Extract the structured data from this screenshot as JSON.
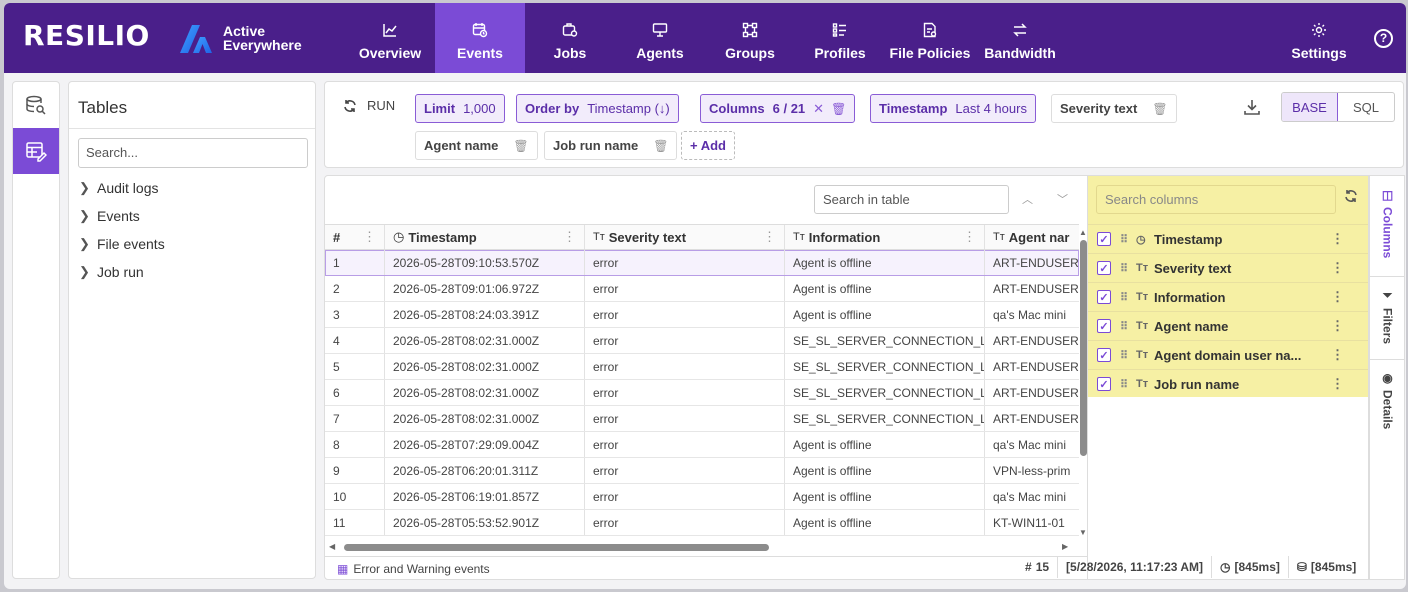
{
  "header": {
    "logo": "RESILIO",
    "product_line1": "Active",
    "product_line2": "Everywhere",
    "nav": [
      {
        "label": "Overview",
        "icon": "chart-line-icon"
      },
      {
        "label": "Events",
        "icon": "calendar-clock-icon",
        "active": true
      },
      {
        "label": "Jobs",
        "icon": "jobs-icon"
      },
      {
        "label": "Agents",
        "icon": "agents-icon"
      },
      {
        "label": "Groups",
        "icon": "groups-icon"
      },
      {
        "label": "Profiles",
        "icon": "profiles-icon"
      },
      {
        "label": "File Policies",
        "icon": "file-policies-icon"
      },
      {
        "label": "Bandwidth",
        "icon": "bandwidth-icon"
      }
    ],
    "settings_label": "Settings",
    "help_label": "?"
  },
  "tables_panel": {
    "title": "Tables",
    "search_placeholder": "Search...",
    "items": [
      "Audit logs",
      "Events",
      "File events",
      "Job run"
    ]
  },
  "query_bar": {
    "run_label": "RUN",
    "limit_key": "Limit",
    "limit_value": "1,000",
    "order_key": "Order by",
    "order_value": "Timestamp (↓)",
    "columns_key": "Columns",
    "columns_value": "6 / 21",
    "timestamp_key": "Timestamp",
    "timestamp_value": "Last 4 hours",
    "severity_chip": "Severity text",
    "agent_chip": "Agent name",
    "jobrun_chip": "Job run name",
    "add_label": "+ Add",
    "mode_base": "BASE",
    "mode_sql": "SQL"
  },
  "grid": {
    "search_placeholder": "Search in table",
    "columns": [
      "#",
      "Timestamp",
      "Severity text",
      "Information",
      "Agent nar"
    ],
    "rows": [
      [
        "1",
        "2026-05-28T09:10:53.570Z",
        "error",
        "Agent is offline",
        "ART-ENDUSER"
      ],
      [
        "2",
        "2026-05-28T09:01:06.972Z",
        "error",
        "Agent is offline",
        "ART-ENDUSER"
      ],
      [
        "3",
        "2026-05-28T08:24:03.391Z",
        "error",
        "Agent is offline",
        "qa's Mac mini"
      ],
      [
        "4",
        "2026-05-28T08:02:31.000Z",
        "error",
        "SE_SL_SERVER_CONNECTION_L...",
        "ART-ENDUSER"
      ],
      [
        "5",
        "2026-05-28T08:02:31.000Z",
        "error",
        "SE_SL_SERVER_CONNECTION_L...",
        "ART-ENDUSER"
      ],
      [
        "6",
        "2026-05-28T08:02:31.000Z",
        "error",
        "SE_SL_SERVER_CONNECTION_L...",
        "ART-ENDUSER"
      ],
      [
        "7",
        "2026-05-28T08:02:31.000Z",
        "error",
        "SE_SL_SERVER_CONNECTION_L...",
        "ART-ENDUSER"
      ],
      [
        "8",
        "2026-05-28T07:29:09.004Z",
        "error",
        "Agent is offline",
        "qa's Mac mini"
      ],
      [
        "9",
        "2026-05-28T06:20:01.311Z",
        "error",
        "Agent is offline",
        "VPN-less-prim"
      ],
      [
        "10",
        "2026-05-28T06:19:01.857Z",
        "error",
        "Agent is offline",
        "qa's Mac mini"
      ],
      [
        "11",
        "2026-05-28T05:53:52.901Z",
        "error",
        "Agent is offline",
        "KT-WIN11-01"
      ]
    ],
    "footer_label": "Error and Warning events"
  },
  "columns_panel": {
    "search_placeholder": "Search columns",
    "items": [
      {
        "label": "Timestamp",
        "type": "clock-icon"
      },
      {
        "label": "Severity text",
        "type": "text-type-icon"
      },
      {
        "label": "Information",
        "type": "text-type-icon"
      },
      {
        "label": "Agent name",
        "type": "text-type-icon"
      },
      {
        "label": "Agent domain user na...",
        "type": "text-type-icon"
      },
      {
        "label": "Job run name",
        "type": "text-type-icon"
      }
    ],
    "tabs": [
      "Columns",
      "Filters",
      "Details"
    ]
  },
  "status_bar": {
    "rows_label": "#",
    "rows_count": "15",
    "timestamp": "[5/28/2026, 11:17:23 AM]",
    "query_time": "[845ms]",
    "db_time": "[845ms]"
  },
  "colors": {
    "header_bg": "#4a1f8a",
    "accent": "#7b4bd6",
    "highlight_yellow": "#f6f0a4"
  }
}
